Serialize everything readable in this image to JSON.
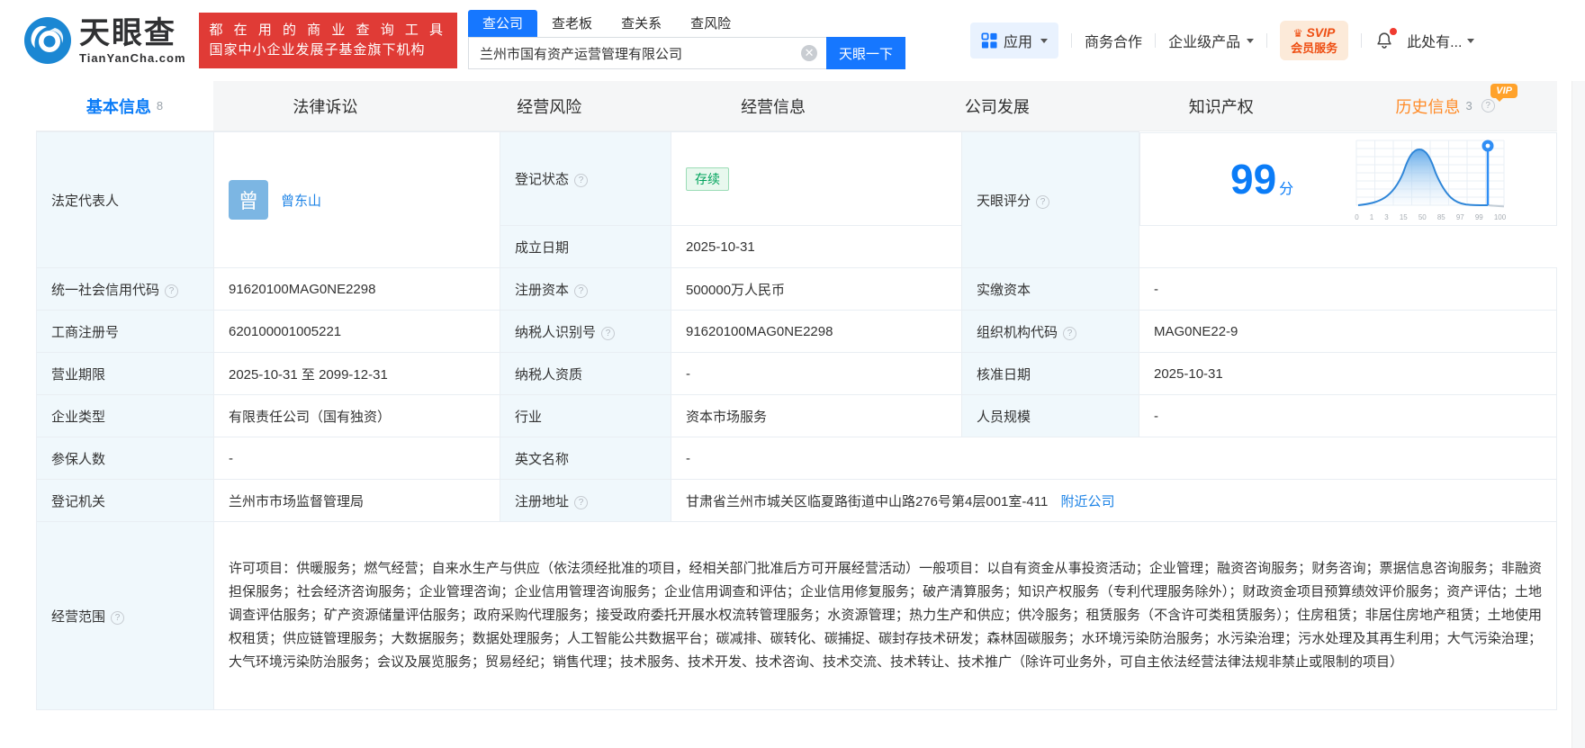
{
  "header": {
    "logo": {
      "title": "天眼查",
      "domain": "TianYanCha.com"
    },
    "banner": {
      "line1": "都 在 用 的 商 业 查 询 工 具",
      "line2": "国家中小企业发展子基金旗下机构"
    },
    "search": {
      "tabs": [
        "查公司",
        "查老板",
        "查关系",
        "查风险"
      ],
      "value": "兰州市国有资产运营管理有限公司",
      "button": "天眼一下"
    },
    "nav": {
      "apps": "应用",
      "business_coop": "商务合作",
      "enterprise_products": "企业级产品",
      "svip_title": "SVIP",
      "svip_subtitle": "会员服务",
      "user_menu": "此处有..."
    }
  },
  "tabs": {
    "basic": {
      "label": "基本信息",
      "count": "8"
    },
    "legal": {
      "label": "法律诉讼"
    },
    "risk": {
      "label": "经营风险"
    },
    "operation": {
      "label": "经营信息"
    },
    "development": {
      "label": "公司发展"
    },
    "ip": {
      "label": "知识产权"
    },
    "history": {
      "label": "历史信息",
      "count": "3",
      "vip_badge": "VIP"
    }
  },
  "company": {
    "legal_rep": {
      "label": "法定代表人",
      "avatar": "曾",
      "name": "曾东山"
    },
    "reg_status": {
      "label": "登记状态",
      "value": "存续"
    },
    "establish_date": {
      "label": "成立日期",
      "value": "2025-10-31"
    },
    "score": {
      "label": "天眼评分",
      "value": "99",
      "unit": "分",
      "ticks": [
        "0",
        "1",
        "3",
        "15",
        "50",
        "85",
        "97",
        "99",
        "100"
      ]
    },
    "credit_code": {
      "label": "统一社会信用代码",
      "value": "91620100MAG0NE2298"
    },
    "reg_capital": {
      "label": "注册资本",
      "value": "500000万人民币"
    },
    "paid_capital": {
      "label": "实缴资本",
      "value": "-"
    },
    "reg_number": {
      "label": "工商注册号",
      "value": "620100001005221"
    },
    "taxpayer_id": {
      "label": "纳税人识别号",
      "value": "91620100MAG0NE2298"
    },
    "org_code": {
      "label": "组织机构代码",
      "value": "MAG0NE22-9"
    },
    "business_term": {
      "label": "营业期限",
      "value": "2025-10-31 至 2099-12-31"
    },
    "taxpayer_quality": {
      "label": "纳税人资质",
      "value": "-"
    },
    "approval_date": {
      "label": "核准日期",
      "value": "2025-10-31"
    },
    "company_type": {
      "label": "企业类型",
      "value": "有限责任公司（国有独资）"
    },
    "industry": {
      "label": "行业",
      "value": "资本市场服务"
    },
    "staff_size": {
      "label": "人员规模",
      "value": "-"
    },
    "insured_count": {
      "label": "参保人数",
      "value": "-"
    },
    "english_name": {
      "label": "英文名称",
      "value": "-"
    },
    "reg_authority": {
      "label": "登记机关",
      "value": "兰州市市场监督管理局"
    },
    "reg_address": {
      "label": "注册地址",
      "value": "甘肃省兰州市城关区临夏路街道中山路276号第4层001室-411",
      "nearby_link": "附近公司"
    },
    "business_scope": {
      "label": "经营范围",
      "value": "许可项目：供暖服务；燃气经营；自来水生产与供应（依法须经批准的项目，经相关部门批准后方可开展经营活动）一般项目：以自有资金从事投资活动；企业管理；融资咨询服务；财务咨询；票据信息咨询服务；非融资担保服务；社会经济咨询服务；企业管理咨询；企业信用管理咨询服务；企业信用调查和评估；企业信用修复服务；破产清算服务；知识产权服务（专利代理服务除外）；财政资金项目预算绩效评价服务；资产评估；土地调查评估服务；矿产资源储量评估服务；政府采购代理服务；接受政府委托开展水权流转管理服务；水资源管理；热力生产和供应；供冷服务；租赁服务（不含许可类租赁服务）；住房租赁；非居住房地产租赁；土地使用权租赁；供应链管理服务；大数据服务；数据处理服务；人工智能公共数据平台；碳减排、碳转化、碳捕捉、碳封存技术研发；森林固碳服务；水环境污染防治服务；水污染治理；污水处理及其再生利用；大气污染治理；大气环境污染防治服务；会议及展览服务；贸易经纪；销售代理；技术服务、技术开发、技术咨询、技术交流、技术转让、技术推广（除许可业务外，可自主依法经营法律法规非禁止或限制的项目）"
    }
  },
  "colors": {
    "brand_blue": "#1677ff",
    "link_blue": "#1d83e6",
    "banner_red": "#e03b36",
    "status_green": "#00a35c",
    "score_blue": "#0b7cf7",
    "vip_orange": "#ffa22b",
    "svip_text": "#ee4e12"
  }
}
